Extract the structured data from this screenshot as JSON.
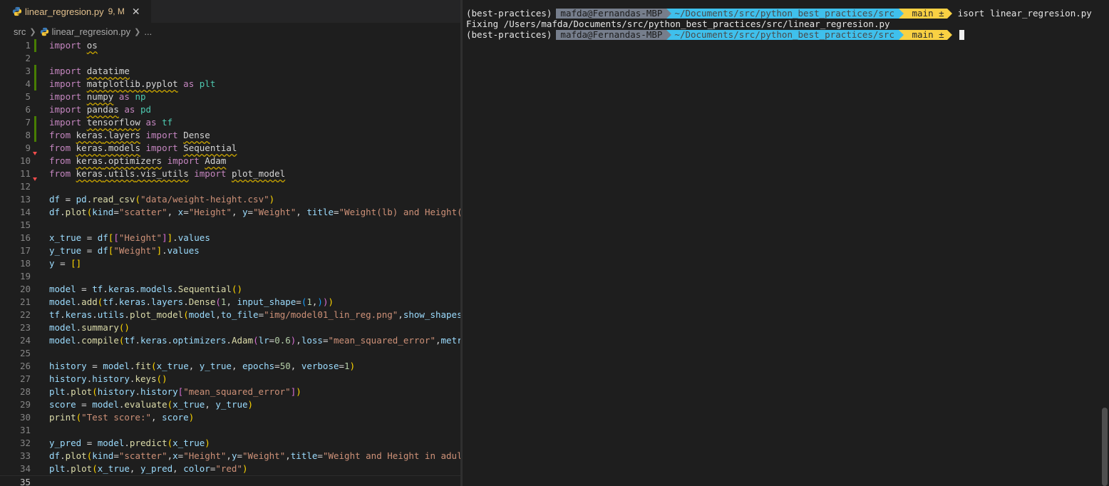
{
  "editor": {
    "tab": {
      "filename": "linear_regresion.py",
      "meta": "9, M",
      "close": "✕"
    },
    "breadcrumb": {
      "folder": "src",
      "file": "linear_regresion.py",
      "more": "..."
    },
    "lines": [
      {
        "n": "1",
        "text": "import os"
      },
      {
        "n": "2",
        "text": ""
      },
      {
        "n": "3",
        "text": "import datatime"
      },
      {
        "n": "4",
        "text": "import matplotlib.pyplot as plt"
      },
      {
        "n": "5",
        "text": "import numpy as np"
      },
      {
        "n": "6",
        "text": "import pandas as pd"
      },
      {
        "n": "7",
        "text": "import tensorflow as tf"
      },
      {
        "n": "8",
        "text": "from keras.layers import Dense"
      },
      {
        "n": "9",
        "text": "from keras.models import Sequential"
      },
      {
        "n": "10",
        "text": "from keras.optimizers import Adam"
      },
      {
        "n": "11",
        "text": "from keras.utils.vis_utils import plot_model"
      },
      {
        "n": "12",
        "text": ""
      },
      {
        "n": "13",
        "text": "df = pd.read_csv(\"data/weight-height.csv\")"
      },
      {
        "n": "14",
        "text": "df.plot(kind=\"scatter\", x=\"Height\", y=\"Weight\", title=\"Weight(lb) and Height(in)"
      },
      {
        "n": "15",
        "text": ""
      },
      {
        "n": "16",
        "text": "x_true = df[[\"Height\"]].values"
      },
      {
        "n": "17",
        "text": "y_true = df[\"Weight\"].values"
      },
      {
        "n": "18",
        "text": "y = []"
      },
      {
        "n": "19",
        "text": ""
      },
      {
        "n": "20",
        "text": "model = tf.keras.models.Sequential()"
      },
      {
        "n": "21",
        "text": "model.add(tf.keras.layers.Dense(1, input_shape=(1,)))"
      },
      {
        "n": "22",
        "text": "tf.keras.utils.plot_model(model,to_file=\"img/model01_lin_reg.png\",show_shapes=Tr"
      },
      {
        "n": "23",
        "text": "model.summary()"
      },
      {
        "n": "24",
        "text": "model.compile(tf.keras.optimizers.Adam(lr=0.6),loss=\"mean_squared_error\",metrics="
      },
      {
        "n": "25",
        "text": ""
      },
      {
        "n": "26",
        "text": "history = model.fit(x_true, y_true, epochs=50, verbose=1)"
      },
      {
        "n": "27",
        "text": "history.history.keys()"
      },
      {
        "n": "28",
        "text": "plt.plot(history.history[\"mean_squared_error\"])"
      },
      {
        "n": "29",
        "text": "score = model.evaluate(x_true, y_true)"
      },
      {
        "n": "30",
        "text": "print(\"Test score:\", score)"
      },
      {
        "n": "31",
        "text": ""
      },
      {
        "n": "32",
        "text": "y_pred = model.predict(x_true)"
      },
      {
        "n": "33",
        "text": "df.plot(kind=\"scatter\",x=\"Height\",y=\"Weight\",title=\"Weight and Height in adults\""
      },
      {
        "n": "34",
        "text": "plt.plot(x_true, y_pred, color=\"red\")"
      },
      {
        "n": "35",
        "text": ""
      }
    ]
  },
  "terminal": {
    "prompt": {
      "env": "(best-practices)",
      "user": "mafda@Fernandas-MBP",
      "path": "~/Documents/src/python_best_practices/src",
      "git": " main ±"
    },
    "command": "isort linear_regresion.py",
    "output": "Fixing /Users/mafda/Documents/src/python_best_practices/src/linear_regresion.py"
  },
  "colors": {
    "git_added": "#487e02",
    "error": "#f14c4c",
    "prompt_user_bg": "#767e8c",
    "prompt_path_bg": "#3fc0ec",
    "prompt_git_bg": "#f9d143"
  }
}
